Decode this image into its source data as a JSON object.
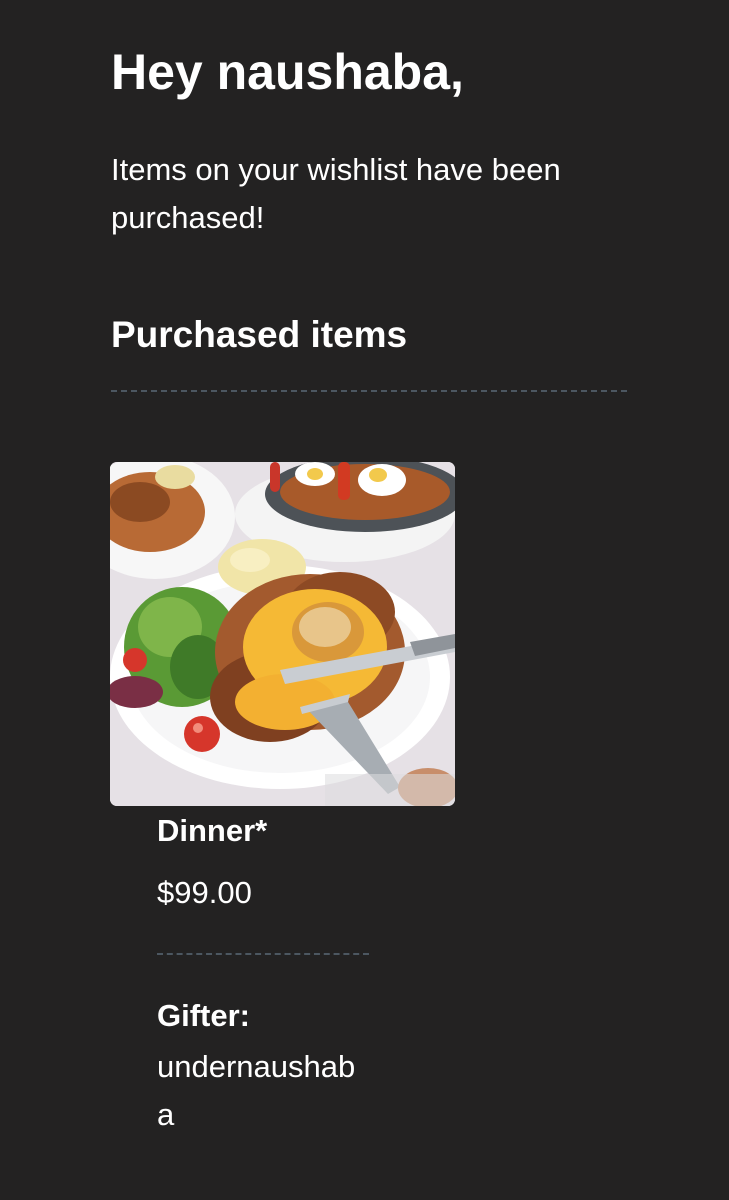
{
  "email": {
    "greeting": "Hey naushaba,",
    "intro": "Items on your wishlist have been purchased!",
    "section_title": "Purchased items"
  },
  "items": [
    {
      "image_icon": "dinner-plate-photo",
      "name": "Dinner*",
      "price": "$99.00",
      "gifter_label": "Gifter:",
      "gifter_name": "undernaushaba"
    }
  ],
  "colors": {
    "background": "#232222",
    "text": "#ffffff",
    "divider": "#4c5761"
  }
}
